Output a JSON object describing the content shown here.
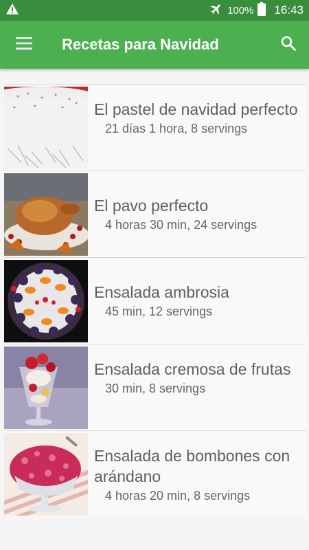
{
  "status_bar": {
    "battery": "100%",
    "time": "16:43",
    "icons": [
      "warning-icon",
      "airplane-mode-icon",
      "battery-icon"
    ]
  },
  "app_bar": {
    "title": "Recetas para Navidad",
    "icons": [
      "menu-icon",
      "search-icon"
    ]
  },
  "recipes": [
    {
      "title": "El pastel de navidad perfecto",
      "meta": "21 días 1 hora, 8 servings"
    },
    {
      "title": "El pavo perfecto",
      "meta": "4 horas 30 min, 24 servings"
    },
    {
      "title": "Ensalada ambrosia",
      "meta": "45 min, 12 servings"
    },
    {
      "title": "Ensalada cremosa de frutas",
      "meta": "30 min, 8 servings"
    },
    {
      "title": "Ensalada de bombones con arándano",
      "meta": "4 horas 20 min, 8 servings"
    }
  ],
  "colors": {
    "status_bar": "#388E3C",
    "app_bar": "#4CAF50",
    "background": "#f5f5f5"
  }
}
